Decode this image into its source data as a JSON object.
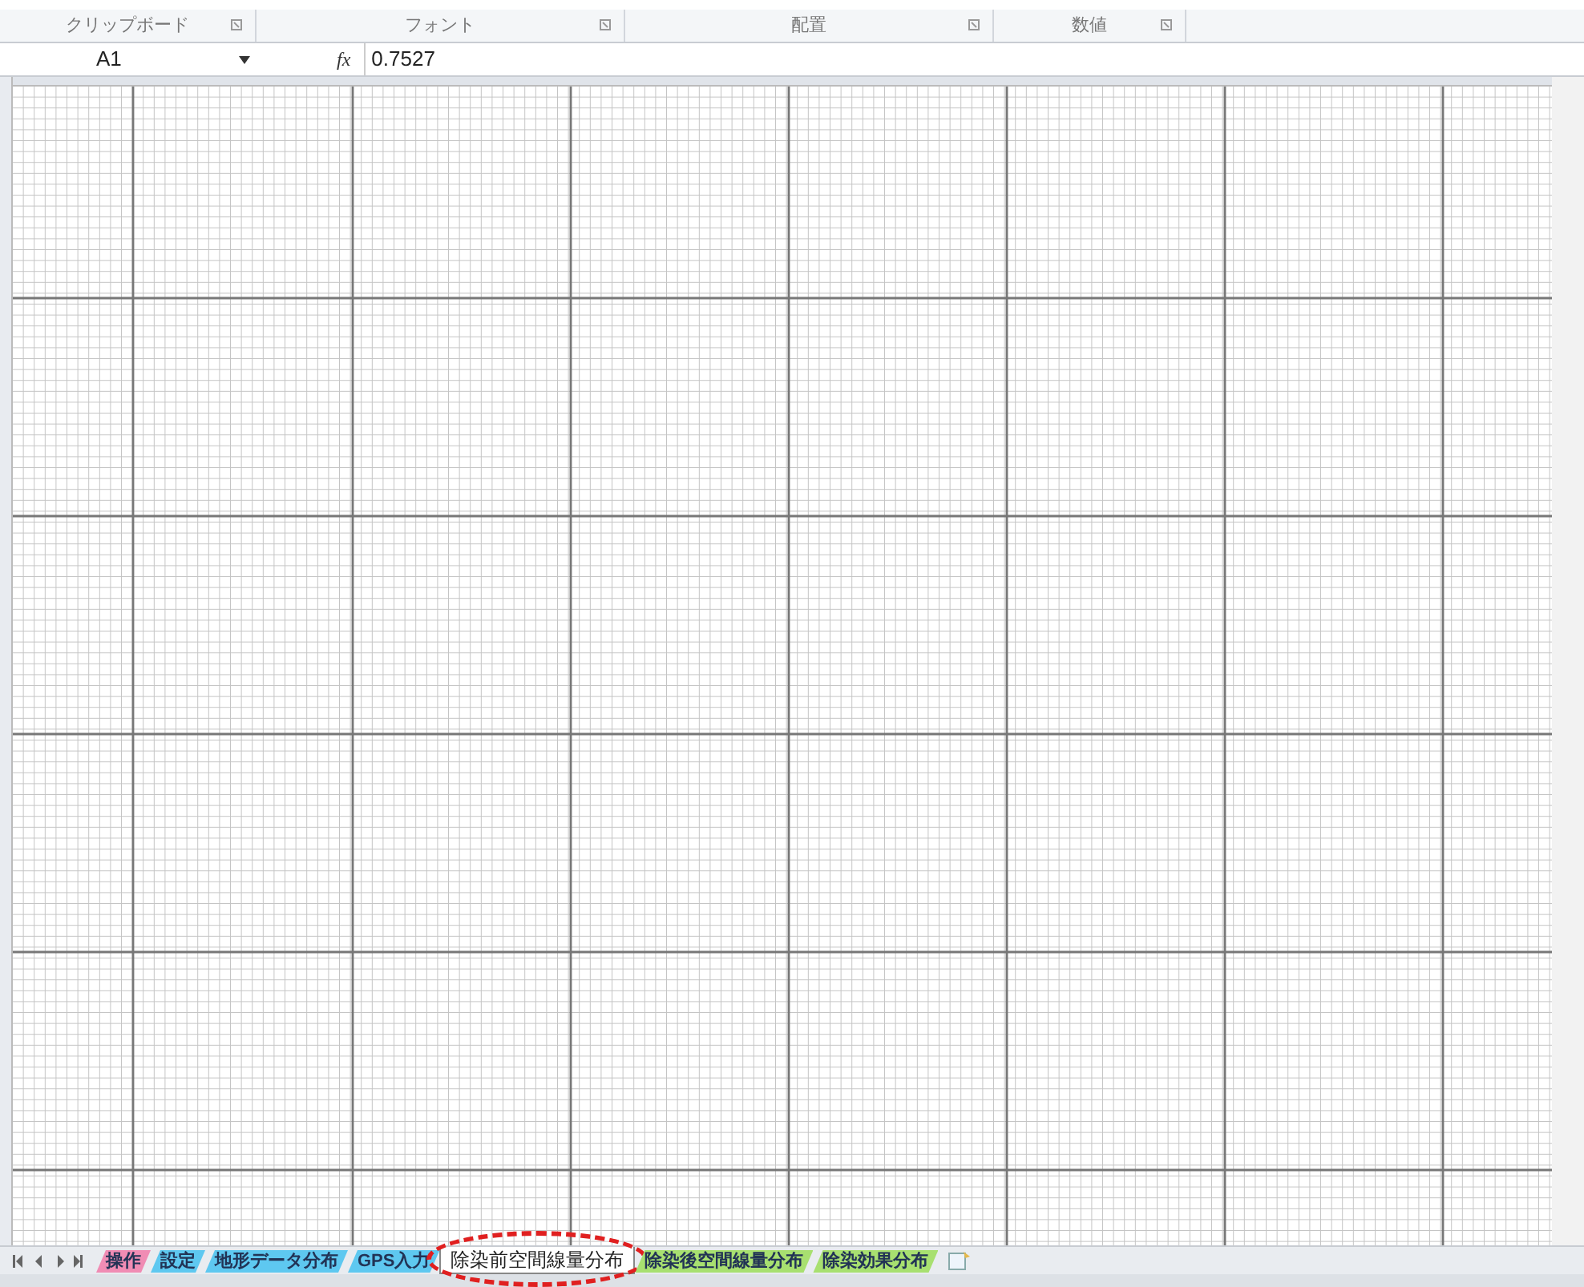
{
  "ribbon": {
    "groups": [
      {
        "label": "クリップボード"
      },
      {
        "label": "フォント"
      },
      {
        "label": "配置"
      },
      {
        "label": "数値"
      }
    ]
  },
  "formula_bar": {
    "name_box": "A1",
    "fx": "fx",
    "value": "0.7527"
  },
  "sheet_tabs": [
    {
      "label": "操作",
      "color": "#f08cb4",
      "selected": false
    },
    {
      "label": "設定",
      "color": "#5ec8f0",
      "selected": false
    },
    {
      "label": "地形データ分布",
      "color": "#5ec8f0",
      "selected": false
    },
    {
      "label": "GPS入力",
      "color": "#5ec8f0",
      "selected": false
    },
    {
      "label": "除染前空間線量分布",
      "color": "#ffffff",
      "selected": true
    },
    {
      "label": "除染後空間線量分布",
      "color": "#a8e070",
      "selected": false
    },
    {
      "label": "除染効果分布",
      "color": "#a8e070",
      "selected": false
    }
  ]
}
